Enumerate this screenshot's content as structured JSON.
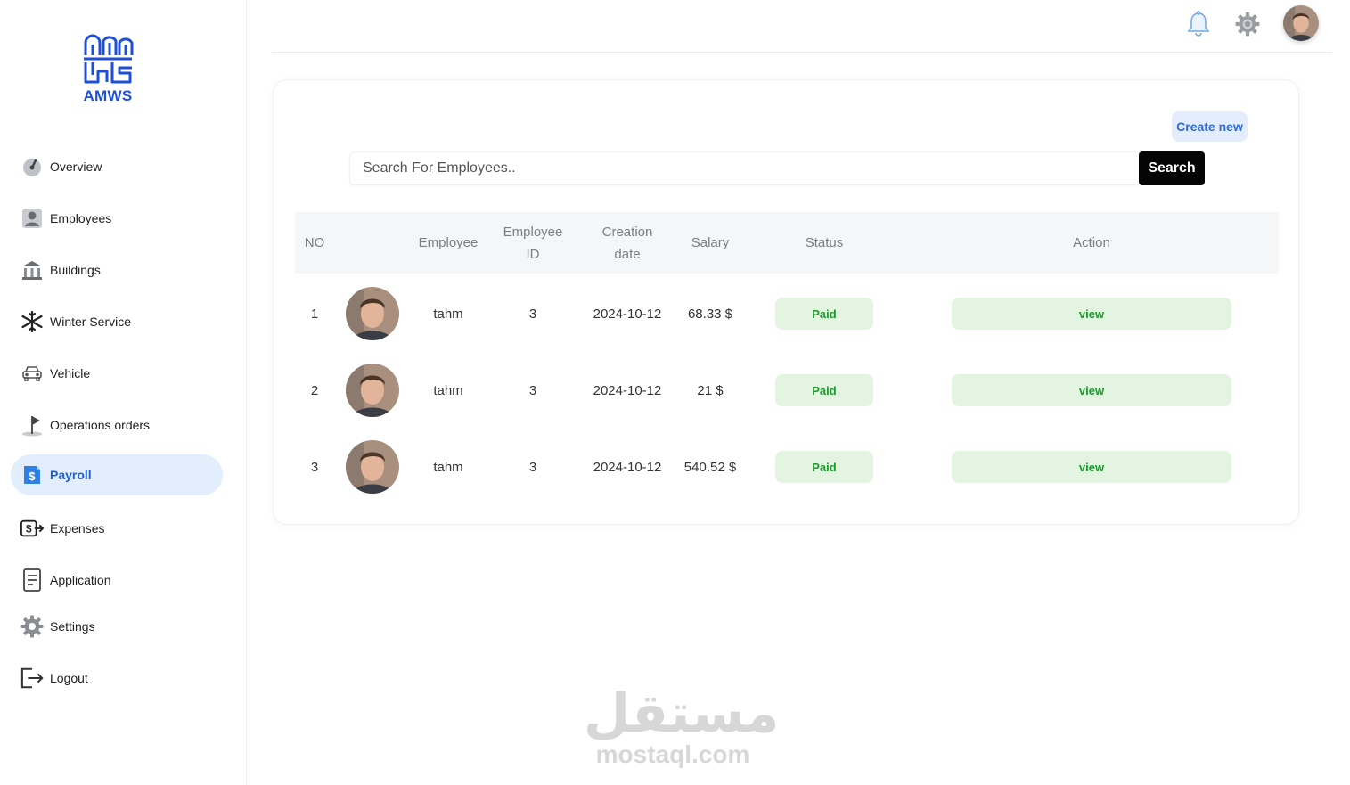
{
  "brand": {
    "name": "AMWS",
    "color": "#1e4fd8"
  },
  "sidebar": {
    "items": [
      {
        "label": "Overview",
        "icon": "gauge-icon"
      },
      {
        "label": "Employees",
        "icon": "person-icon"
      },
      {
        "label": "Buildings",
        "icon": "bank-building-icon"
      },
      {
        "label": "Winter Service",
        "icon": "snowflake-icon"
      },
      {
        "label": "Vehicle",
        "icon": "car-icon"
      },
      {
        "label": "Operations orders",
        "icon": "flag-icon"
      },
      {
        "label": "Payroll",
        "icon": "payroll-dollar-icon",
        "active": true
      },
      {
        "label": "Expenses",
        "icon": "cash-out-icon"
      },
      {
        "label": "Application",
        "icon": "document-icon"
      },
      {
        "label": "Settings",
        "icon": "gear-icon"
      },
      {
        "label": "Logout",
        "icon": "logout-icon"
      }
    ]
  },
  "topbar": {
    "icons": [
      "bell-icon",
      "gear-icon",
      "user-avatar"
    ]
  },
  "main": {
    "create_label": "Create new",
    "search_placeholder": "Search For Employees..",
    "search_label": "Search",
    "table": {
      "headers": [
        "NO",
        "Employee",
        "Employee ID",
        "Creation date",
        "Salary",
        "Status",
        "Action"
      ],
      "rows": [
        {
          "no": "1",
          "employee": "tahm",
          "employee_id": "3",
          "creation_date": "2024-10-12",
          "salary": "68.33 $",
          "status": "Paid",
          "action": "view"
        },
        {
          "no": "2",
          "employee": "tahm",
          "employee_id": "3",
          "creation_date": "2024-10-12",
          "salary": "21 $",
          "status": "Paid",
          "action": "view"
        },
        {
          "no": "3",
          "employee": "tahm",
          "employee_id": "3",
          "creation_date": "2024-10-12",
          "salary": "540.52 $",
          "status": "Paid",
          "action": "view"
        }
      ]
    }
  },
  "watermark": {
    "arabic": "مستقل",
    "latin": "mostaql.com"
  },
  "colors": {
    "accent": "#1e5fd6",
    "active_bg": "#e2eefc",
    "paid_bg": "#e3f5e1",
    "paid_text": "#1b9a2c",
    "search_button": "#050505"
  }
}
